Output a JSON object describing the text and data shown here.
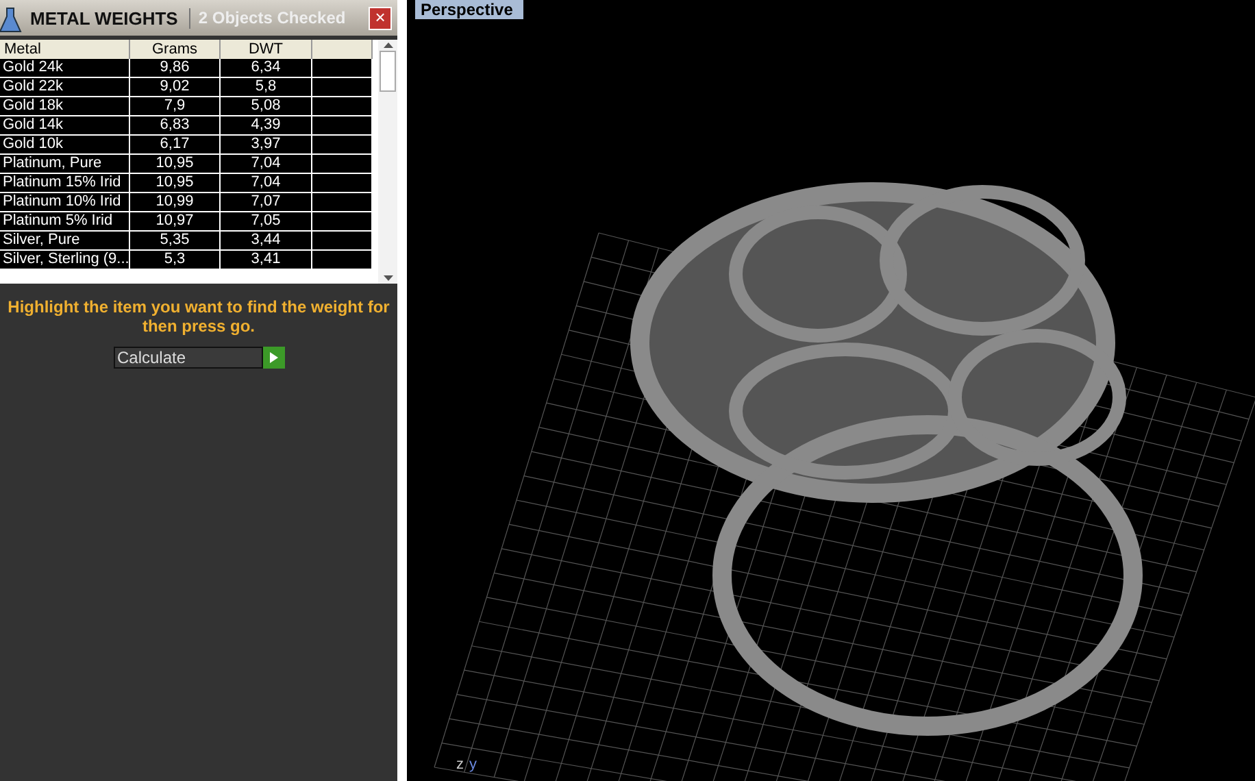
{
  "panel": {
    "title": "METAL WEIGHTS",
    "status": "2 Objects Checked",
    "close": "×"
  },
  "table": {
    "columns": [
      "Metal",
      "Grams",
      "DWT"
    ],
    "rows": [
      {
        "metal": "Gold 24k",
        "grams": "9,86",
        "dwt": "6,34"
      },
      {
        "metal": "Gold 22k",
        "grams": "9,02",
        "dwt": "5,8"
      },
      {
        "metal": "Gold 18k",
        "grams": "7,9",
        "dwt": "5,08"
      },
      {
        "metal": "Gold 14k",
        "grams": "6,83",
        "dwt": "4,39"
      },
      {
        "metal": "Gold 10k",
        "grams": "6,17",
        "dwt": "3,97"
      },
      {
        "metal": "Platinum, Pure",
        "grams": "10,95",
        "dwt": "7,04"
      },
      {
        "metal": "Platinum 15% Irid",
        "grams": "10,95",
        "dwt": "7,04"
      },
      {
        "metal": "Platinum 10% Irid",
        "grams": "10,99",
        "dwt": "7,07"
      },
      {
        "metal": "Platinum 5% Irid",
        "grams": "10,97",
        "dwt": "7,05"
      },
      {
        "metal": "Silver, Pure",
        "grams": "5,35",
        "dwt": "3,44"
      },
      {
        "metal": "Silver, Sterling (9...",
        "grams": "5,3",
        "dwt": "3,41"
      }
    ]
  },
  "instruction": "Highlight the item you want to find the weight for then press go.",
  "action": {
    "value": "Calculate"
  },
  "viewport": {
    "label": "Perspective",
    "axes": [
      "z",
      "y"
    ]
  }
}
